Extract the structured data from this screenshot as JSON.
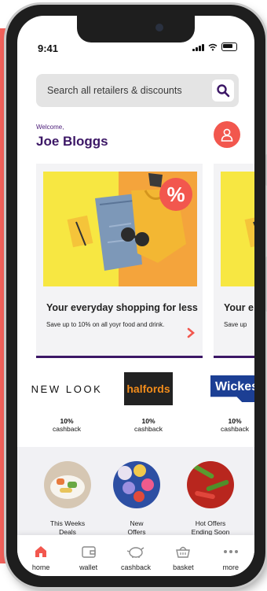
{
  "status": {
    "time": "9:41"
  },
  "search": {
    "placeholder": "Search all retailers & discounts"
  },
  "header": {
    "welcome": "Welcome,",
    "user_name": "Joe Bloggs"
  },
  "promo_cards": [
    {
      "badge": "%",
      "title": "Your everyday shopping for less",
      "subtitle": "Save up to 10% on all yoyr food and drink."
    },
    {
      "title": "Your e",
      "subtitle": "Save up"
    }
  ],
  "retailers": [
    {
      "logo": "NEW LOOK",
      "cashback_pct": "10%",
      "cashback_label": "cashback"
    },
    {
      "logo": "halfords",
      "cashback_pct": "10%",
      "cashback_label": "cashback"
    },
    {
      "logo": "Wickes",
      "cashback_pct": "10%",
      "cashback_label": "cashback"
    }
  ],
  "deals": [
    {
      "label_line1": "This Weeks",
      "label_line2": "Deals"
    },
    {
      "label_line1": "New",
      "label_line2": "Offers"
    },
    {
      "label_line1": "Hot Offers",
      "label_line2": "Ending Soon"
    }
  ],
  "tabs": [
    {
      "label": "home",
      "icon": "home-icon",
      "active": true
    },
    {
      "label": "wallet",
      "icon": "wallet-icon"
    },
    {
      "label": "cashback",
      "icon": "piggy-bank-icon"
    },
    {
      "label": "basket",
      "icon": "basket-icon"
    },
    {
      "label": "more",
      "icon": "more-dots-icon"
    }
  ],
  "colors": {
    "accent": "#f2574e",
    "brand_purple": "#3c1766",
    "halfords_orange": "#f28c1b",
    "wickes_blue": "#1c3f94"
  }
}
